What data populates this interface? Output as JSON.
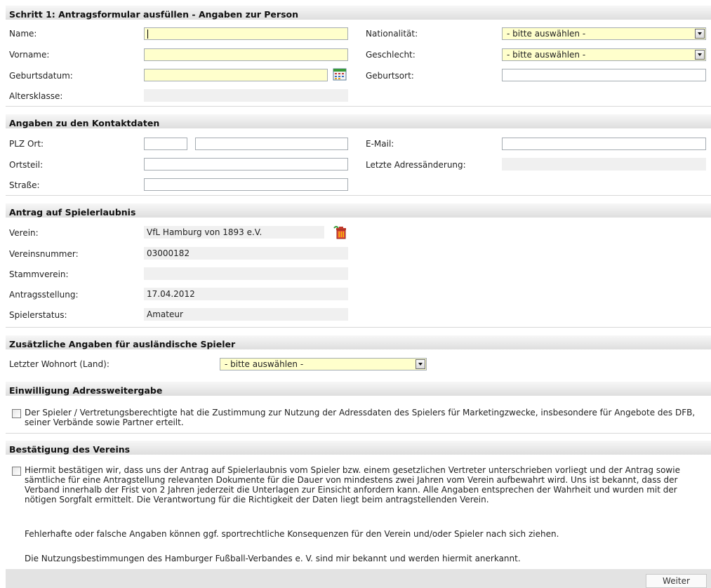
{
  "sections": {
    "person": "Schritt 1: Antragsformular ausfüllen - Angaben zur Person",
    "contact": "Angaben zu den Kontaktdaten",
    "permit": "Antrag auf Spielerlaubnis",
    "foreign": "Zusätzliche Angaben für ausländische Spieler",
    "consent": "Einwilligung Adressweitergabe",
    "confirm": "Bestätigung des Vereins"
  },
  "person": {
    "name_label": "Name:",
    "vorname_label": "Vorname:",
    "geburtsdatum_label": "Geburtsdatum:",
    "altersklasse_label": "Altersklasse:",
    "nationalitaet_label": "Nationalität:",
    "nationalitaet_value": "- bitte auswählen -",
    "geschlecht_label": "Geschlecht:",
    "geschlecht_value": "- bitte auswählen -",
    "geburtsort_label": "Geburtsort:"
  },
  "contact": {
    "plz_ort_label": "PLZ Ort:",
    "ortsteil_label": "Ortsteil:",
    "strasse_label": "Straße:",
    "email_label": "E-Mail:",
    "letzte_adressaenderung_label": "Letzte Adressänderung:"
  },
  "permit": {
    "verein_label": "Verein:",
    "verein_value": "VfL Hamburg von 1893 e.V.",
    "vereinsnummer_label": "Vereinsnummer:",
    "vereinsnummer_value": "03000182",
    "stammverein_label": "Stammverein:",
    "antragsstellung_label": "Antragsstellung:",
    "antragsstellung_value": "17.04.2012",
    "spielerstatus_label": "Spielerstatus:",
    "spielerstatus_value": "Amateur"
  },
  "foreign": {
    "wohnort_label": "Letzter Wohnort (Land):",
    "wohnort_value": "- bitte auswählen -"
  },
  "consent": {
    "text": "Der Spieler / Vertretungsberechtigte hat die Zustimmung zur Nutzung der Adressdaten des Spielers für Marketingzwecke, insbesondere für Angebote des DFB, seiner Verbände sowie Partner erteilt."
  },
  "confirm": {
    "text": "Hiermit bestätigen wir, dass uns der Antrag auf Spielerlaubnis vom Spieler bzw. einem gesetzlichen Vertreter unterschrieben vorliegt und der Antrag sowie sämtliche für eine Antragstellung relevanten Dokumente für die Dauer von mindestens zwei Jahren vom Verein aufbewahrt wird. Uns ist bekannt, dass der Verband innerhalb der Frist von 2 Jahren jederzeit die Unterlagen zur Einsicht anfordern kann. Alle Angaben entsprechen der Wahrheit und wurden mit der nötigen Sorgfalt ermittelt. Die Verantwortung für die Richtigkeit der Daten liegt beim antragstellenden Verein.",
    "note1": "Fehlerhafte oder falsche Angaben können ggf. sportrechtliche Konsequenzen für den Verein und/oder Spieler nach sich ziehen.",
    "note2": "Die Nutzungsbestimmungen des Hamburger Fußball-Verbandes e. V. sind mir bekannt und werden hiermit anerkannt."
  },
  "footer": {
    "weiter_label": "Weiter"
  },
  "colors": {
    "required_bg": "#ffffcc",
    "readonly_bg": "#f0f0f0",
    "header_bg": "#dedede"
  },
  "icons": {
    "calendar": "calendar-icon",
    "delete": "trash-icon"
  }
}
